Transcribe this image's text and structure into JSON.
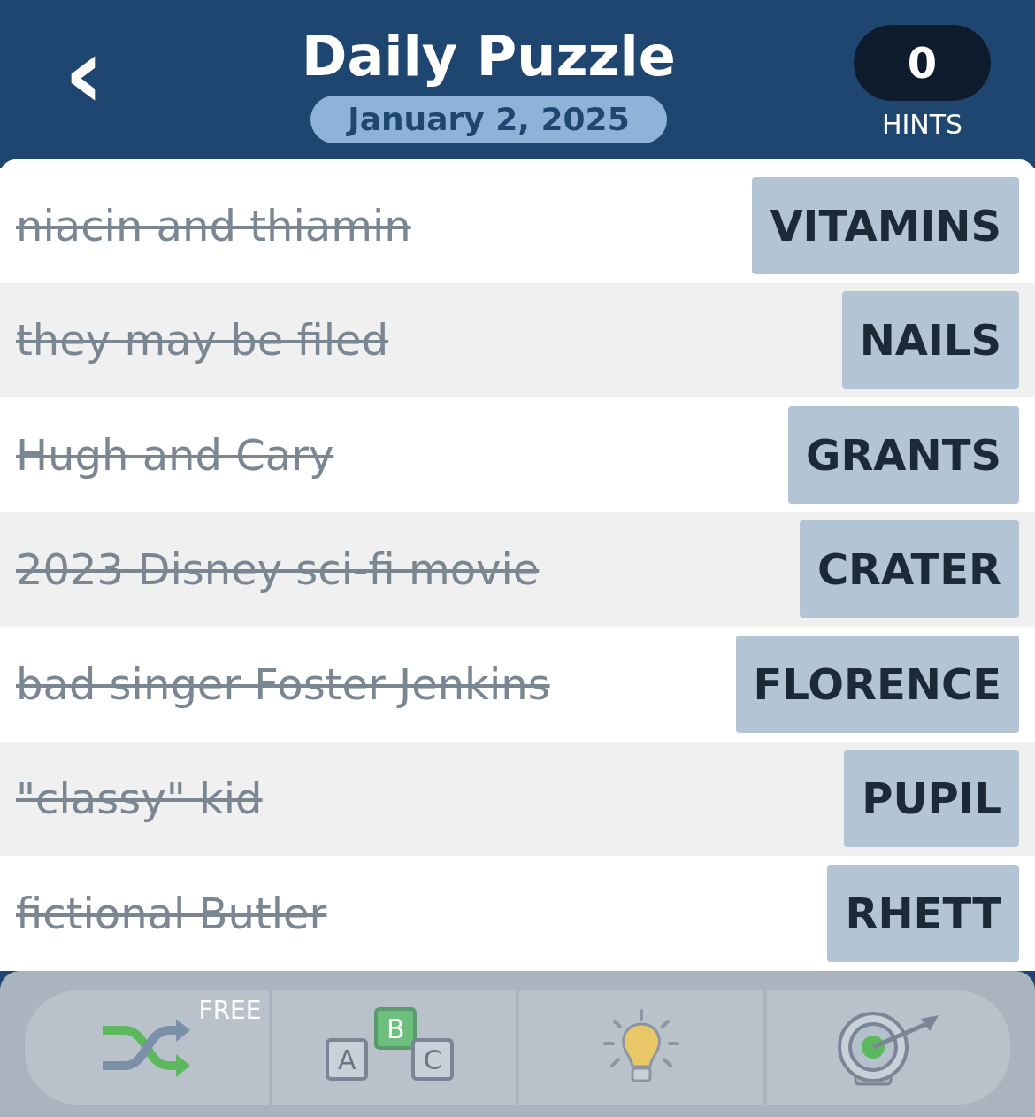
{
  "header": {
    "back": "‹",
    "title": "Daily Puzzle",
    "date": "January 2, 2025",
    "hints_count": "0",
    "hints_label": "HINTS"
  },
  "clues": [
    {
      "clue": "niacin and thiamin",
      "answer": "VITAMINS",
      "solved": true
    },
    {
      "clue": "they may be filed",
      "answer": "NAILS",
      "solved": true
    },
    {
      "clue": "Hugh and Cary",
      "answer": "GRANTS",
      "solved": true
    },
    {
      "clue": "2023 Disney sci-fi movie",
      "answer": "CRATER",
      "solved": true
    },
    {
      "clue": "bad singer Foster Jenkins",
      "answer": "FLORENCE",
      "solved": true
    },
    {
      "clue": "\"classy\" kid",
      "answer": "PUPIL",
      "solved": true
    },
    {
      "clue": "fictional Butler",
      "answer": "RHETT",
      "solved": true
    }
  ],
  "toolbar": [
    {
      "kind": "shuffle",
      "badge": "FREE"
    },
    {
      "kind": "letters",
      "letters": [
        "A",
        "B",
        "C"
      ]
    },
    {
      "kind": "bulb"
    },
    {
      "kind": "target"
    }
  ]
}
